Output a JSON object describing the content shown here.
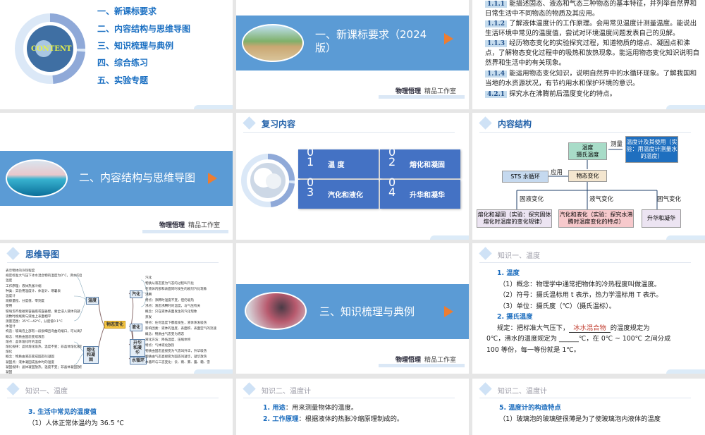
{
  "toc": {
    "emblem": "CONTENT",
    "items": [
      "一、新课标要求",
      "二、内容结构与思维导图",
      "三、知识梳理与典例",
      "四、综合练习",
      "五、实验专题"
    ]
  },
  "footer": {
    "brand": "物理悟理",
    "studio": "精品工作室"
  },
  "sections": {
    "s1": "一、新课标要求（2024版）",
    "s2": "二、内容结构与思维导图",
    "s3": "三、知识梳理与典例"
  },
  "standards": [
    {
      "code": "1.1.1",
      "text": "能描述固态、液态和气态三种物态的基本特征，并列举自然界和日常生活中不同物态的物质及其应用。"
    },
    {
      "code": "1.1.2",
      "text": "了解液体温度计的工作原理。会用常见温度计测量温度。能说出生活环境中常见的温度值，尝试对环境温度问题发表自己的见解。"
    },
    {
      "code": "1.1.3",
      "text": "经历物态变化的实验探究过程，知道物质的熔点、凝固点和沸点，了解物态变化过程中的吸热和放热现象。能运用物态变化知识说明自然界和生活中的有关现象。"
    },
    {
      "code": "1.1.4",
      "text": "能运用物态变化知识，说明自然界中的水循环现象。了解我国和当地的水资源状况，有节约用水和保护环境的意识。"
    },
    {
      "code": "4.2.1",
      "text": "探究水在沸腾前后温度变化的特点。"
    }
  ],
  "review": {
    "title": "复习内容",
    "tiles": [
      {
        "n": "01",
        "label": "温 度"
      },
      {
        "n": "02",
        "label": "熔化和凝固"
      },
      {
        "n": "03",
        "label": "汽化和液化"
      },
      {
        "n": "04",
        "label": "升华和凝华"
      }
    ]
  },
  "structure": {
    "title": "内容结构",
    "temp": "温度\n摄氏温度",
    "measure": "测量",
    "thermo": "温度计及其使用（实验：用温度计测量水的温度）",
    "apply": "应用",
    "sts": "STS  水循环",
    "change": "物态变化",
    "e1": "固液变化",
    "e2": "液气变化",
    "e3": "固气变化",
    "b1": "熔化和凝固（实验：探究固体熔化时温度的变化规律）",
    "b2": "汽化和液化（实验：探究水沸腾时温度变化的特点）",
    "b3": "升华和凝华"
  },
  "mindmap": {
    "title": "思维导图",
    "center": "物态变化",
    "nodes": [
      "温度",
      "熔化和凝固",
      "汽化",
      "液化",
      "升华和凝华",
      "水循环"
    ],
    "left": [
      "表示物体的冷热程度",
      "规定标准大气压下冰水混合物的温度为0°C，沸水的温度100°C",
      "温度",
      "工作原理：液体热胀冷缩",
      "种类：实验用温度计、体温计、寒暑表",
      "温度计",
      "观察量程、分度值、零刻度",
      "使用",
      "玻璃泡不能碰到容器底或容器壁，要全浸入液体内部",
      "读数时视线要与液柱上表面相平",
      "测量范围：35°C~42°C，分度值0.1°C",
      "体温计",
      "构造：玻璃泡上部有一段很细且弯曲的缩口，可以离开人体读数",
      "概念：物质由固态变成液态",
      "熔点：晶体熔化时的温度",
      "熔化规律：晶体熔化吸热，温度不变；非晶体熔化吸热，温度升高",
      "熔化",
      "概念：物质由液态变成固态叫凝固",
      "凝固点：液体凝固成晶体时的温度",
      "凝固规律：晶体凝固放热，温度不变；非晶体凝固放热，温度持续下降",
      "凝固"
    ],
    "right": [
      "汽化",
      "物质从液态变为气态的过程叫汽化",
      "在液体内部和表面同时发生的剧烈汽化现象",
      "沸腾",
      "特点：沸腾时温度不变，但仍吸热",
      "沸点：液态沸腾时的温度，与气压有关",
      "概念：只在液体表面发生的汽化现象",
      "蒸发",
      "特点：任何温度下都能发生，液体蒸发吸热",
      "影响因素：液体的温度、表面积、表面空气的流速",
      "概念：物质由气态变为液态",
      "液化方法：降低温度、压缩体积",
      "特点：气体液化放热",
      "物质由固态直接变为气态叫升华，升华吸热",
      "物质由气态直接变为固态叫凝华，凝华放热",
      "水循环与三态变化：云、雨、雾、露、霜、雪"
    ]
  },
  "k1": {
    "header": "知识一、温度",
    "h1": "1. 温度",
    "l1": "（1）概念：物理学中通常把物体的冷热程度叫做温度。",
    "l2": "（2）符号：摄氏温标用 t 表示，热力学温标用 T 表示。",
    "l3": "（3）单位：摄氏度（℃）（摄氏温标）。",
    "h2": "2. 摄氏温度",
    "p1a": "规定：把标准大气压下，",
    "blank1": "冰水混合物",
    "p1b": "的温度规定为",
    "p2": "0℃，沸水的温度规定为 ______℃，在 0℃ ~ 100℃ 之间分成",
    "p3": "100 等份，每一等份就是 1℃。"
  },
  "k1b": {
    "header": "知识一、温度",
    "h": "3. 生活中常见的温度值",
    "l1": "（1）人体正常体温约为 36.5 ℃"
  },
  "k2": {
    "header": "知识二、温度计",
    "l1h": "1. 用途",
    "l1": "：用来测量物体的温度。",
    "l2h": "2. 工作原理",
    "l2": "：根据液体的热胀冷缩原理制成的。"
  },
  "k2b": {
    "header": "知识二、温度计",
    "h": "5. 温度计的构造特点",
    "l1": "（1）玻璃泡的玻璃壁很薄是为了使玻璃泡内液体的温度"
  }
}
